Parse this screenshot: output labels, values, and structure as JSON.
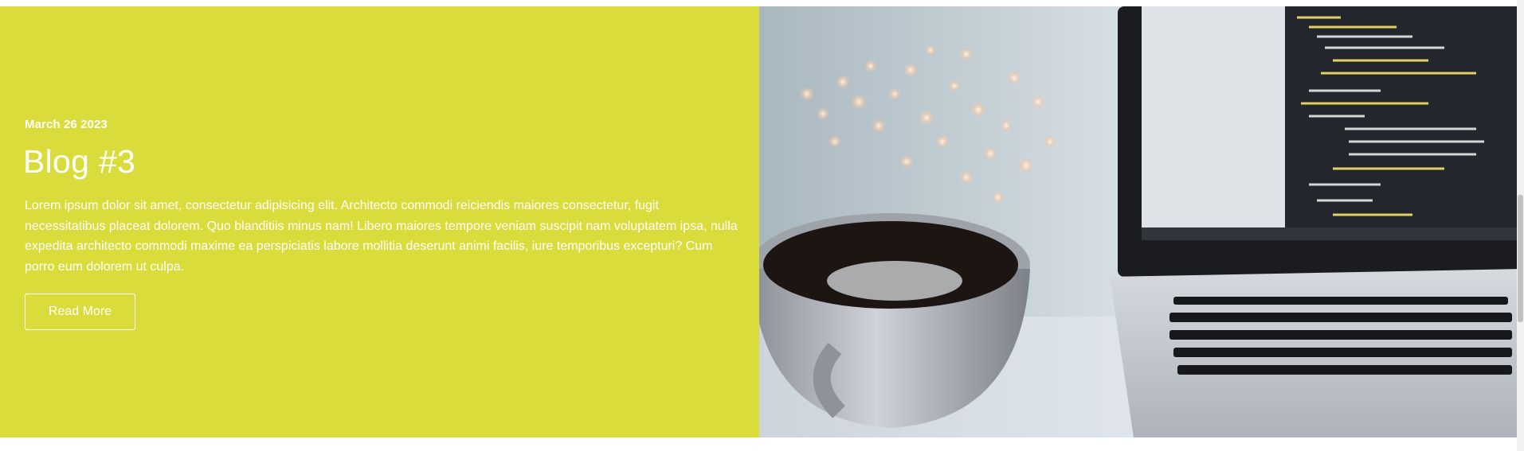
{
  "post": {
    "date": "March 26 2023",
    "title": "Blog #3",
    "excerpt": "Lorem ipsum dolor sit amet, consectetur adipisicing elit. Architecto commodi reiciendis maiores consectetur, fugit necessitatibus placeat dolorem. Quo blanditiis minus nam! Libero maiores tempore veniam suscipit nam voluptatem ipsa, nulla expedita architecto commodi maxime ea perspiciatis labore mollitia deserunt animi facilis, iure temporibus excepturi? Cum porro eum dolorem ut culpa.",
    "read_more_label": "Read More"
  },
  "colors": {
    "accent_panel": "#d9dc3a",
    "text": "#ffffff"
  },
  "image": {
    "subject": "coffee cup beside laptop showing code"
  }
}
